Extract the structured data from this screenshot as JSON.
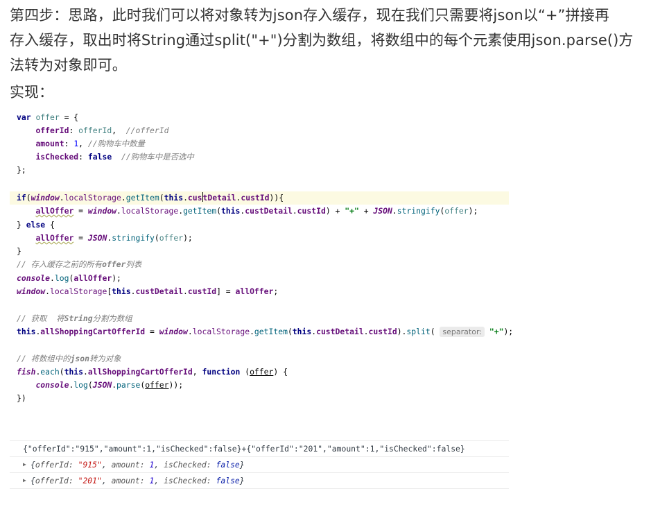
{
  "paragraph": {
    "line1": "第四步：思路，此时我们可以将对象转为json存入缓存，现在我们只需要将json以“+”拼接再",
    "line2": "存入缓存，取出时将String通过split(\"+\")分割为数组，将数组中的每个元素使用json.parse()方",
    "line3": "法转为对象即可。"
  },
  "heading": "实现：",
  "code": {
    "l1": {
      "kw": "var",
      "name": "offer",
      "rest": " = {"
    },
    "l2": {
      "key": "offerId",
      "colon": ": ",
      "val": "offerId",
      "sep": ",  ",
      "cm": "//offerId"
    },
    "l3": {
      "key": "amount",
      "colon": ": ",
      "num": "1",
      "sep": ", ",
      "cm": "//购物车中数量"
    },
    "l4": {
      "key": "isChecked",
      "colon": ": ",
      "kw": "false",
      "sep": "  ",
      "cm": "//购物车中是否选中"
    },
    "l5": "};",
    "l6": {
      "kw": "if",
      "p1": "(",
      "win": "window",
      "dot1": ".",
      "ls": "localStorage",
      "dot2": ".",
      "fn": "getItem",
      "p2": "(",
      "this": "this",
      "dot3": ".",
      "cd_a": "cus",
      "cd_b": "tDetail",
      "dot4": ".",
      "cid": "custId",
      "end": ")){"
    },
    "l7": {
      "all": "allOffer",
      "eq": " = ",
      "win": "window",
      "dot1": ".",
      "ls": "localStorage",
      "dot2": ".",
      "fn": "getItem",
      "p": "(",
      "this": "this",
      "dot3": ".",
      "cd": "custDetail",
      "dot4": ".",
      "cid": "custId",
      "p2": ") + ",
      "str": "\"+\"",
      "plus": " + ",
      "json": "JSON",
      "dot5": ".",
      "fn2": "stringify",
      "p3": "(",
      "arg": "offer",
      "end": ");"
    },
    "l8": {
      "a": "} ",
      "kw": "else",
      "b": " {"
    },
    "l9": {
      "all": "allOffer",
      "eq": " = ",
      "json": "JSON",
      "dot": ".",
      "fn": "stringify",
      "p": "(",
      "arg": "offer",
      "end": ");"
    },
    "l10": "}",
    "l11": {
      "cm1": "// 存入缓存之前的所有",
      "cmb": "offer",
      "cm2": "列表"
    },
    "l12": {
      "console": "console",
      "dot": ".",
      "fn": "log",
      "p": "(",
      "all": "allOffer",
      "end": ");"
    },
    "l13": {
      "win": "window",
      "dot1": ".",
      "ls": "localStorage",
      "br": "[",
      "this": "this",
      "dot2": ".",
      "cd": "custDetail",
      "dot3": ".",
      "cid": "custId",
      "br2": "] = ",
      "all": "allOffer",
      "end": ";"
    },
    "l15": {
      "cm1": "// 获取  将",
      "cmb": "String",
      "cm2": "分割为数组"
    },
    "l16": {
      "this": "this",
      "dot1": ".",
      "arr": "allShoppingCartOfferId",
      "eq": " = ",
      "win": "window",
      "dot2": ".",
      "ls": "localStorage",
      "dot3": ".",
      "fn": "getItem",
      "p": "(",
      "this2": "this",
      "dot4": ".",
      "cd": "custDetail",
      "dot5": ".",
      "cid": "custId",
      "p2": ").",
      "fn2": "split",
      "p3": "( ",
      "hint": "separator:",
      "str": "\"+\"",
      "end": ");"
    },
    "l18": {
      "cm1": "// 将数组中的",
      "cmb": "json",
      "cm2": "转为对象"
    },
    "l19": {
      "fish": "fish",
      "dot": ".",
      "fn": "each",
      "p": "(",
      "this": "this",
      "dot2": ".",
      "arr": "allShoppingCartOfferId",
      "comma": ", ",
      "kw": "function",
      "p2": " (",
      "arg": "offer",
      "end": ") {"
    },
    "l20": {
      "console": "console",
      "dot": ".",
      "fn": "log",
      "p": "(",
      "json": "JSON",
      "dot2": ".",
      "fn2": "parse",
      "p2": "(",
      "arg": "offer",
      "end": "));"
    },
    "l21": "})"
  },
  "console": {
    "raw": "{\"offerId\":\"915\",\"amount\":1,\"isChecked\":false}+{\"offerId\":\"201\",\"amount\":1,\"isChecked\":false}",
    "obj1": {
      "open": "{",
      "k1": "offerId: ",
      "v1": "\"915\"",
      "c1": ", ",
      "k2": "amount: ",
      "v2": "1",
      "c2": ", ",
      "k3": "isChecked: ",
      "v3": "false",
      "close": "}"
    },
    "obj2": {
      "open": "{",
      "k1": "offerId: ",
      "v1": "\"201\"",
      "c1": ", ",
      "k2": "amount: ",
      "v2": "1",
      "c2": ", ",
      "k3": "isChecked: ",
      "v3": "false",
      "close": "}"
    },
    "expand_icon": "triangle-right-icon"
  }
}
